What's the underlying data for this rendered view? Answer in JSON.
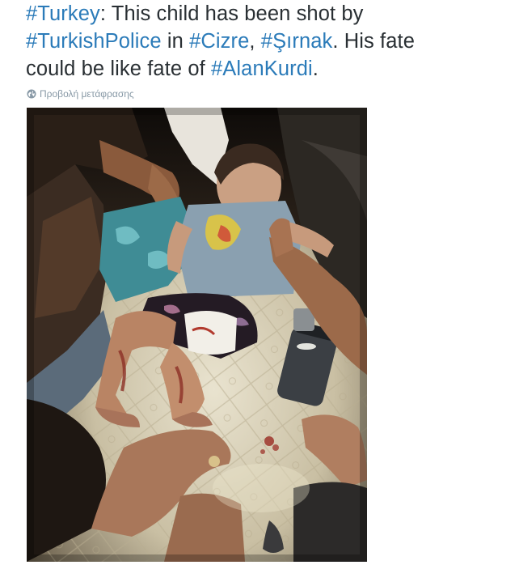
{
  "tweet": {
    "line1": {
      "hashtag_turkey": "#Turkey",
      "text_a": ": This child has been shot by"
    },
    "line2": {
      "hashtag_police": "#TurkishPolice",
      "text_in": " in ",
      "hashtag_cizre": "#Cizre",
      "text_comma": ", ",
      "hashtag_sirnak": "#Şırnak",
      "text_his": ". His fate"
    },
    "line3": {
      "text_could": "could be like fate of ",
      "hashtag_alan": "#AlanKurdi",
      "text_dot": "."
    }
  },
  "translate": {
    "icon": "globe-icon",
    "label": "Προβολή μετάφρασης"
  },
  "media": {
    "type": "photo"
  },
  "colors": {
    "text": "#292f33",
    "link": "#2b7bb9",
    "muted": "#8899a6"
  }
}
